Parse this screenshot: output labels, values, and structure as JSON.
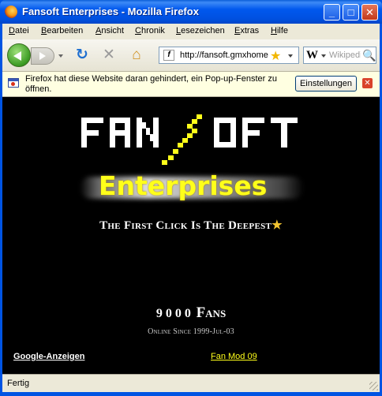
{
  "window": {
    "title": "Fansoft Enterprises - Mozilla Firefox",
    "controls": {
      "minimize": "_",
      "maximize": "□",
      "close": "✕"
    }
  },
  "menubar": {
    "items": [
      {
        "label": "Datei",
        "accel": "D",
        "rest": "atei"
      },
      {
        "label": "Bearbeiten",
        "accel": "B",
        "rest": "earbeiten"
      },
      {
        "label": "Ansicht",
        "accel": "A",
        "rest": "nsicht"
      },
      {
        "label": "Chronik",
        "accel": "C",
        "rest": "hronik"
      },
      {
        "label": "Lesezeichen",
        "accel": "L",
        "rest": "esezeichen"
      },
      {
        "label": "Extras",
        "accel": "E",
        "rest": "xtras"
      },
      {
        "label": "Hilfe",
        "accel": "H",
        "rest": "ilfe"
      }
    ]
  },
  "navbar": {
    "url": "http://fansoft.gmxhome.de/",
    "favicon_glyph": "f",
    "search_engine_glyph": "W",
    "search_placeholder": "Wikipedia",
    "icons": {
      "reload": "↻",
      "stop": "✕",
      "home": "⌂",
      "bookmark_star": "★",
      "search_glass": "🔍"
    }
  },
  "notification": {
    "text": "Firefox hat diese Website daran gehindert, ein Pop-up-Fenster zu öffnen.",
    "settings_button": "Einstellungen",
    "close_glyph": "✕"
  },
  "page": {
    "logo_text": "FANSOFT",
    "logo_subtitle": "Enterprises",
    "tagline": "The First Click Is The Deepest",
    "tagline_star": "★",
    "fans_count": "9000",
    "fans_label": "Fans",
    "online_since": "Online Since 1999-Jul-03",
    "links": {
      "google_ads": "Google-Anzeigen",
      "fan_mod": "Fan Mod 09"
    },
    "colors": {
      "background": "#000000",
      "accent_yellow": "#ffff1a",
      "text": "#ffffff"
    }
  },
  "statusbar": {
    "text": "Fertig"
  }
}
